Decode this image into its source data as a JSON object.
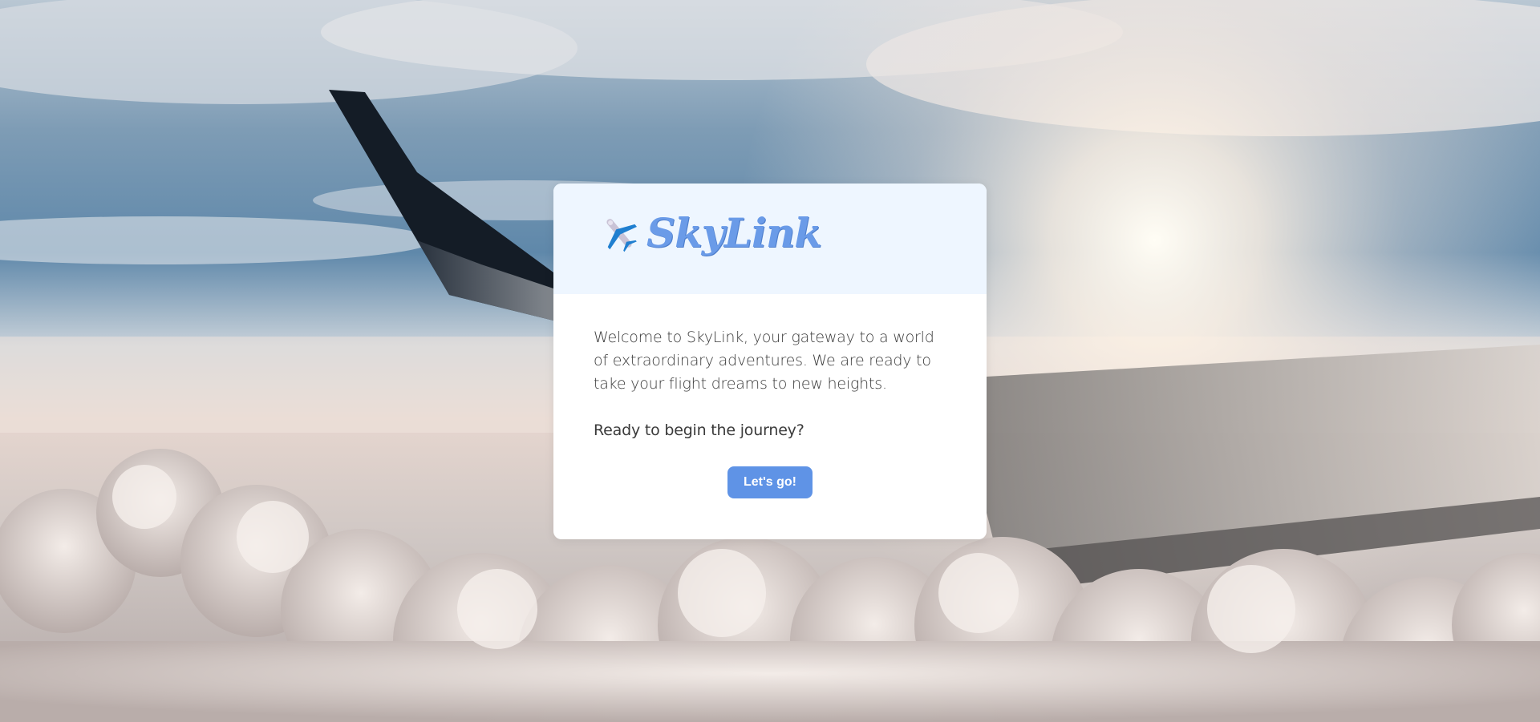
{
  "brand": {
    "name": "SkyLink",
    "icon": "airplane-icon",
    "color": "#6a9be8"
  },
  "welcome": {
    "message": "Welcome to SkyLink, your gateway to a world of extraordinary adventures. We are ready to take your flight dreams to new heights.",
    "question": "Ready to begin the journey?",
    "button_label": "Let's go!",
    "button_color": "#5f93e6"
  }
}
